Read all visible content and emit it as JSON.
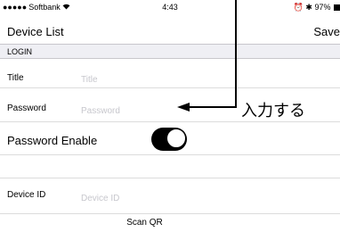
{
  "status_bar": {
    "signal": "●●●●●",
    "carrier": "Softbank",
    "wifi_icon": "wifi-icon",
    "time": "4:43",
    "right_icons": "⏰ ✱",
    "battery": "97%"
  },
  "nav": {
    "title": "Device List",
    "save_label": "Save"
  },
  "section": {
    "header": "LOGIN"
  },
  "form": {
    "title_label": "Title",
    "title_placeholder": "Title",
    "title_value": "",
    "password_label": "Password",
    "password_placeholder": "Password",
    "password_value": "",
    "password_enable_label": "Password Enable",
    "password_enable_on": true,
    "device_id_label": "Device ID",
    "device_id_placeholder": "Device ID",
    "device_id_value": "",
    "scan_qr_label": "Scan QR"
  },
  "annotation": {
    "text": "入力する"
  }
}
